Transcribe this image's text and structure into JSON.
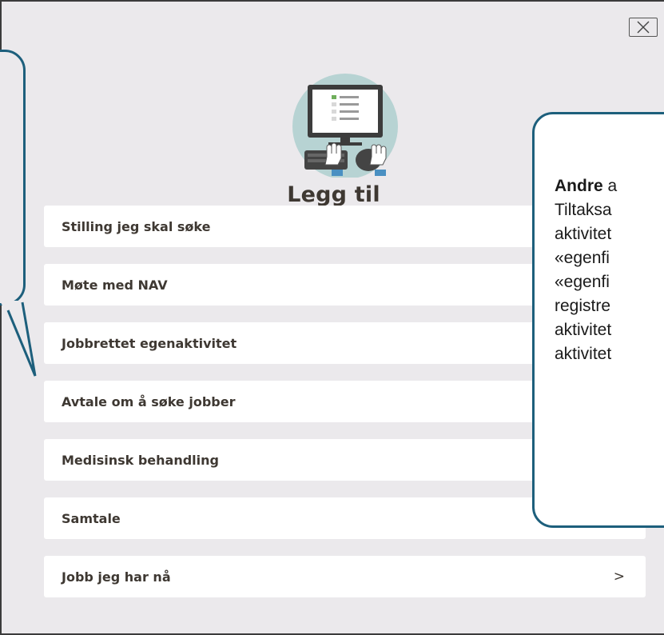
{
  "modal": {
    "title": "Legg til",
    "close_icon": "close-icon",
    "illustration_icon": "computer-keyboard-illustration"
  },
  "items": [
    {
      "label": "Stilling jeg skal søke",
      "chevron": ""
    },
    {
      "label": "Møte med NAV",
      "chevron": ""
    },
    {
      "label": "Jobbrettet egenaktivitet",
      "chevron": ""
    },
    {
      "label": "Avtale om å søke jobber",
      "chevron": ""
    },
    {
      "label": "Medisinsk behandling",
      "chevron": ""
    },
    {
      "label": "Samtale",
      "chevron": ">"
    },
    {
      "label": "Jobb jeg har nå",
      "chevron": ">"
    }
  ],
  "callout": {
    "heading_bold": "Andre",
    "heading_rest": " a",
    "lines": [
      "Tiltaksa",
      "aktivitet",
      "«egenfi",
      "«egenfi",
      "registre",
      "aktivitet",
      "aktivitet"
    ]
  },
  "colors": {
    "modal_bg": "#ebe9ec",
    "callout_border": "#1d5f7c",
    "text": "#3e3832",
    "illustration_circle": "#b7d3d3"
  }
}
